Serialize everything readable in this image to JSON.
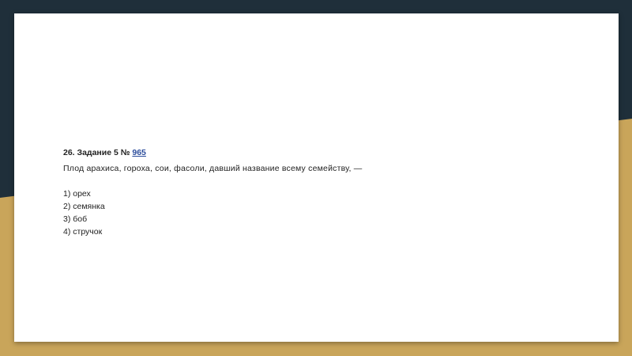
{
  "colors": {
    "background_dark": "#1f2f3a",
    "background_gold": "#c9a55a",
    "slide": "#ffffff",
    "text": "#222222",
    "link": "#2b4c9b"
  },
  "task": {
    "heading_prefix": "26. Задание 5 № ",
    "task_number_link": "965",
    "question": "Плод арахиса, гороха, сои, фасоли, давший название всему семейству, —",
    "options": [
      "1) орех",
      "2) семянка",
      "3) боб",
      "4) стручок"
    ]
  }
}
